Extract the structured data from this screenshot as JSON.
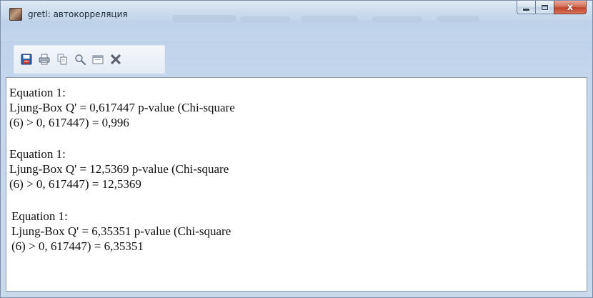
{
  "window": {
    "title": "gretl: автокорреляция",
    "controls": {
      "minimize_icon": "minimize-icon",
      "maximize_icon": "maximize-icon",
      "close_glyph": "x"
    }
  },
  "toolbar": {
    "buttons": [
      {
        "name": "save-button",
        "icon": "save-icon"
      },
      {
        "name": "print-button",
        "icon": "print-icon"
      },
      {
        "name": "copy-button",
        "icon": "copy-icon"
      },
      {
        "name": "find-button",
        "icon": "magnifier-icon"
      },
      {
        "name": "restore-button",
        "icon": "window-icon"
      },
      {
        "name": "close-view-button",
        "icon": "close-x-icon"
      }
    ]
  },
  "results": [
    {
      "line1": "Equation 1:",
      "line2": "Ljung-Box Q' = 0,617447 p-value (Chi-square",
      "line3": "(6) > 0, 617447) = 0,996"
    },
    {
      "line1": "Equation 1:",
      "line2": "Ljung-Box  Q'  =  12,5369  p-value  (Chi-square",
      "line3": "(6) > 0, 617447) = 12,5369"
    },
    {
      "line1": "Equation 1:",
      "line2": "Ljung-Box  Q'  =  6,35351  p-value  (Chi-square",
      "line3": "(6) > 0, 617447) = 6,35351"
    }
  ],
  "colors": {
    "frame_accent": "#c4d6ec",
    "close_button": "#c1432a"
  }
}
